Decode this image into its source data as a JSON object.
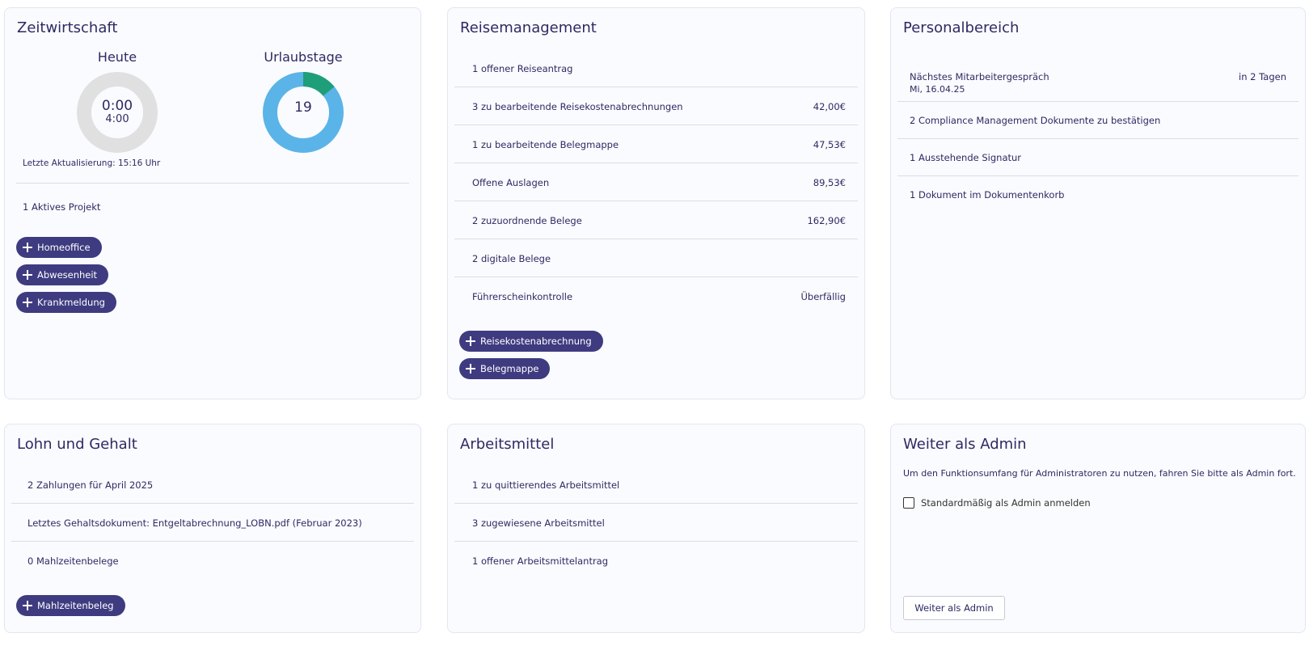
{
  "zeit": {
    "title": "Zeitwirtschaft",
    "today_label": "Heute",
    "today_value": "0:00",
    "today_target": "4:00",
    "vacation_label": "Urlaubstage",
    "vacation_value": "19",
    "vacation_used_fraction": 0.14,
    "colors": {
      "ring_gray": "#e0e0e0",
      "ring_blue": "#5ab4e8",
      "ring_green": "#1e9f7a"
    },
    "last_update": "Letzte Aktualisierung: 15:16 Uhr",
    "project": "1 Aktives Projekt",
    "buttons": [
      "Homeoffice",
      "Abwesenheit",
      "Krankmeldung"
    ]
  },
  "reise": {
    "title": "Reisemanagement",
    "rows": [
      {
        "label": "1 offener Reiseantrag",
        "value": ""
      },
      {
        "label": "3 zu bearbeitende Reisekostenabrechnungen",
        "value": "42,00€"
      },
      {
        "label": "1 zu bearbeitende Belegmappe",
        "value": "47,53€"
      },
      {
        "label": "Offene Auslagen",
        "value": "89,53€"
      },
      {
        "label": "2 zuzuordnende Belege",
        "value": "162,90€"
      },
      {
        "label": "2 digitale Belege",
        "value": ""
      },
      {
        "label": "Führerscheinkontrolle",
        "value": "Überfällig"
      }
    ],
    "buttons": [
      "Reisekostenabrechnung",
      "Belegmappe"
    ]
  },
  "personal": {
    "title": "Personalbereich",
    "next_talk_label": "Nächstes Mitarbeitergespräch",
    "next_talk_date": "Mi, 16.04.25",
    "next_talk_in": "in 2 Tagen",
    "rows": [
      "2 Compliance Management Dokumente zu bestätigen",
      "1 Ausstehende Signatur",
      "1 Dokument im Dokumentenkorb"
    ]
  },
  "lohn": {
    "title": "Lohn und Gehalt",
    "rows": [
      "2 Zahlungen für April 2025",
      "Letztes Gehaltsdokument: Entgeltabrechnung_LOBN.pdf (Februar 2023)",
      "0 Mahlzeitenbelege"
    ],
    "button": "Mahlzeitenbeleg"
  },
  "arbeitsmittel": {
    "title": "Arbeitsmittel",
    "rows": [
      "1 zu quittierendes Arbeitsmittel",
      "3 zugewiesene Arbeitsmittel",
      "1 offener Arbeitsmittelantrag"
    ]
  },
  "admin": {
    "title": "Weiter als Admin",
    "description": "Um den Funktionsumfang für Administratoren zu nutzen, fahren Sie bitte als Admin fort.",
    "checkbox_label": "Standardmäßig als Admin anmelden",
    "button": "Weiter als Admin"
  }
}
